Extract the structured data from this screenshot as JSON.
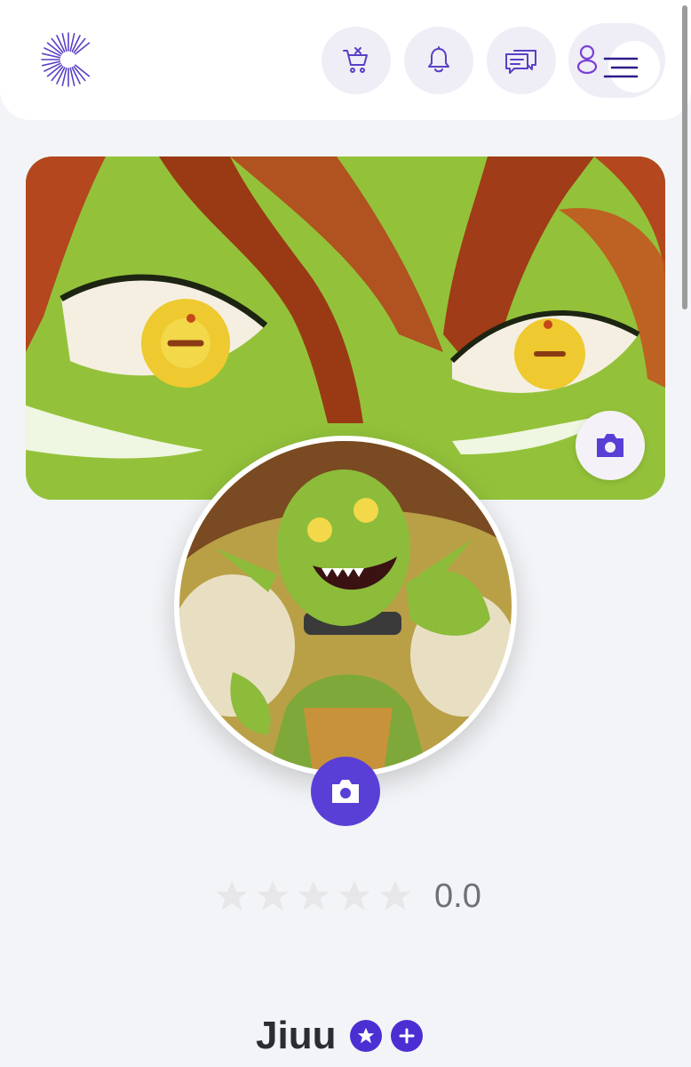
{
  "header": {
    "logo_icon": "sunburst-c-logo",
    "buttons": [
      {
        "icon": "cart-x-icon",
        "label": "cart"
      },
      {
        "icon": "bell-icon",
        "label": "notifications"
      },
      {
        "icon": "chat-bubbles-icon",
        "label": "messages"
      }
    ],
    "account_icon": "person-icon",
    "menu_icon": "hamburger-icon"
  },
  "colors": {
    "accent": "#5a3fd6",
    "icon": "#5b3fc5",
    "banner_green": "#93c23a",
    "hair": "#b4471e"
  },
  "profile": {
    "banner_camera_icon": "camera-icon",
    "avatar_camera_icon": "camera-icon",
    "rating": {
      "stars_filled": 0,
      "stars_total": 5,
      "value": "0.0"
    },
    "name": "Jiuu",
    "badges": [
      "star-badge-icon",
      "plus-badge-icon"
    ]
  }
}
